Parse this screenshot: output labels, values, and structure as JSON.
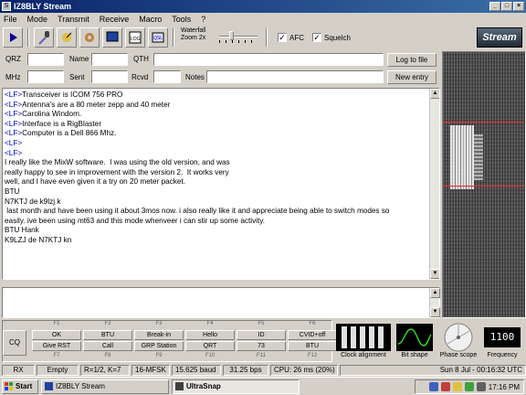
{
  "window": {
    "title": "IZ8BLY Stream"
  },
  "menu": [
    "File",
    "Mode",
    "Transmit",
    "Receive",
    "Macro",
    "Tools",
    "?"
  ],
  "toolbar": {
    "waterfall_label": "Waterfall",
    "zoom_label": "Zoom 2x",
    "afc_label": "AFC",
    "squelch_label": "Squelch",
    "afc_checked": "✓",
    "squelch_checked": "✓",
    "logo": "Stream"
  },
  "log": {
    "qrz_label": "QRZ",
    "name_label": "Name",
    "qth_label": "QTH",
    "mhz_label": "MHz",
    "sent_label": "Sent",
    "rcvd_label": "Rcvd",
    "notes_label": "Notes",
    "log_to_file": "Log to file",
    "new_entry": "New entry"
  },
  "rx_lines": [
    {
      "lf": "<LF>",
      "text": "Transceiver is ICOM 756 PRO"
    },
    {
      "lf": "<LF>",
      "text": "Antenna's are a 80 meter zepp and 40 meter"
    },
    {
      "lf": "<LF>",
      "text": "Carolina Windom."
    },
    {
      "lf": "<LF>",
      "text": "Interface is a RigBlaster"
    },
    {
      "lf": "<LF>",
      "text": "Computer is a Dell 866 Mhz."
    },
    {
      "lf": "<LF>",
      "text": ""
    },
    {
      "lf": "<LF>",
      "text": ""
    },
    {
      "lf": "",
      "text": "I really like the MixW software.  I was using the old version, and was"
    },
    {
      "lf": "",
      "text": "really happy to see in improvement with the version 2.  It works very"
    },
    {
      "lf": "",
      "text": "well, and I have even given it a try on 20 meter packet."
    },
    {
      "lf": "",
      "text": "BTU"
    },
    {
      "lf": "",
      "text": "N7KTJ de k9lzj k"
    },
    {
      "lf": "",
      "text": " last month and have been using it about 3mos now. i also really like it and appreciate being able to switch modes so"
    },
    {
      "lf": "",
      "text": "easily. ive been using mt63 and this mode whenveer i can stir up some activity."
    },
    {
      "lf": "",
      "text": "BTU Hank"
    },
    {
      "lf": "",
      "text": "K9LZJ de N7KTJ kn"
    }
  ],
  "macros": {
    "cq": "CQ",
    "fkeys_top": [
      "F1",
      "F2",
      "F3",
      "F4",
      "F5",
      "F6"
    ],
    "row1": [
      "OK",
      "BTU",
      "Break-in",
      "Hello",
      "ID",
      "CVID+off"
    ],
    "row2": [
      "Give RST",
      "Call",
      "GRP Station",
      "QRT",
      "73",
      "BTU"
    ],
    "fkeys_bottom": [
      "F7",
      "F8",
      "F9",
      "F10",
      "F11",
      "F12"
    ]
  },
  "instruments": {
    "clock_alignment": "Clock alignment",
    "bit_shape": "Bit shape",
    "phase_scope": "Phase scope",
    "frequency": "Frequency",
    "freq_readout": "1100"
  },
  "status": {
    "rx": "RX",
    "squelch": "Empty",
    "code": "R=1/2, K=7",
    "mode": "16-MFSK",
    "baud": "15.625 baud",
    "bps": "31.25 bps",
    "cpu": "CPU: 26 ms (20%)",
    "datetime": "Sun 8 Jul - 00:16:32 UTC"
  },
  "taskbar": {
    "start": "Start",
    "task1": "IZ8BLY Stream",
    "task2": "UltraSnap",
    "clock": "17:16 PM"
  }
}
